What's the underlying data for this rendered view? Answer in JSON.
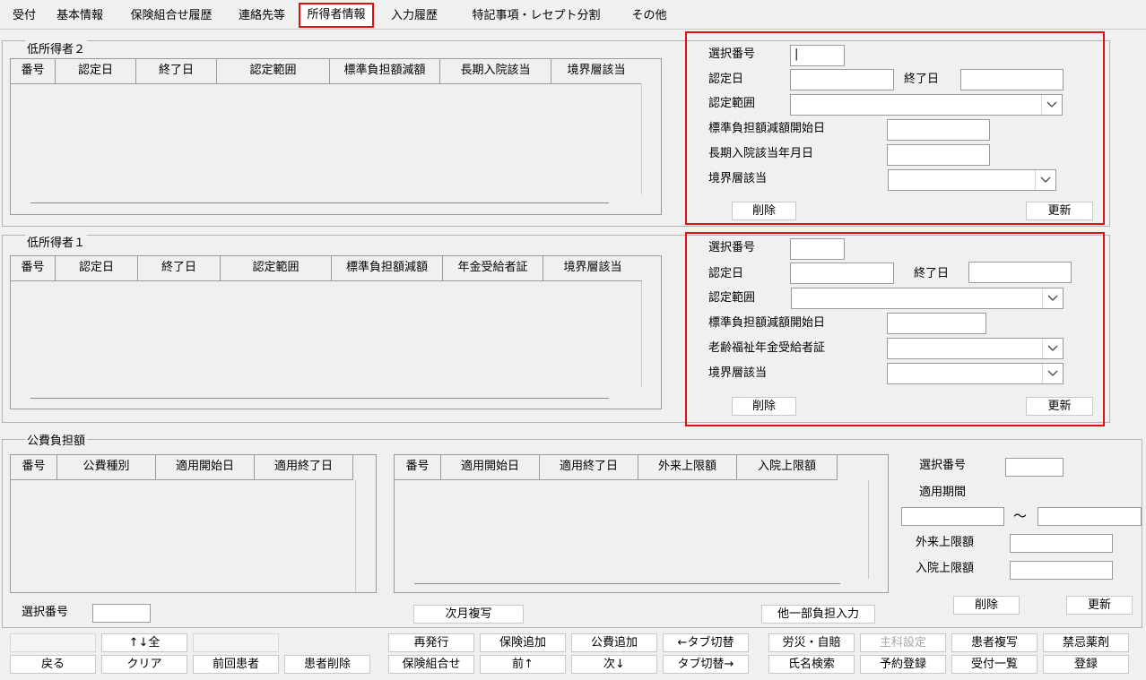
{
  "tabs": [
    {
      "label": "受付"
    },
    {
      "label": "基本情報"
    },
    {
      "label": "保険組合せ履歴"
    },
    {
      "label": "連絡先等"
    },
    {
      "label": "所得者情報"
    },
    {
      "label": "入力履歴"
    },
    {
      "label": "特記事項・レセプト分割"
    },
    {
      "label": "その他"
    }
  ],
  "low_income_2": {
    "title": "低所得者２",
    "columns": [
      "番号",
      "認定日",
      "終了日",
      "認定範囲",
      "標準負担額減額",
      "長期入院該当",
      "境界層該当"
    ],
    "form": {
      "select_number_label": "選択番号",
      "select_number_value": "|",
      "cert_date_label": "認定日",
      "end_date_label": "終了日",
      "cert_range_label": "認定範囲",
      "std_reduction_start_label": "標準負担額減額開始日",
      "long_stay_date_label": "長期入院該当年月日",
      "boundary_label": "境界層該当",
      "delete_label": "削除",
      "update_label": "更新"
    }
  },
  "low_income_1": {
    "title": "低所得者１",
    "columns": [
      "番号",
      "認定日",
      "終了日",
      "認定範囲",
      "標準負担額減額",
      "年金受給者証",
      "境界層該当"
    ],
    "form": {
      "select_number_label": "選択番号",
      "cert_date_label": "認定日",
      "end_date_label": "終了日",
      "cert_range_label": "認定範囲",
      "std_reduction_start_label": "標準負担額減額開始日",
      "pension_label": "老齢福祉年金受給者証",
      "boundary_label": "境界層該当",
      "delete_label": "削除",
      "update_label": "更新"
    }
  },
  "public_burden": {
    "title": "公費負担額",
    "left_columns": [
      "番号",
      "公費種別",
      "適用開始日",
      "適用終了日"
    ],
    "right_columns": [
      "番号",
      "適用開始日",
      "適用終了日",
      "外来上限額",
      "入院上限額"
    ],
    "select_number_label": "選択番号",
    "next_month_copy_label": "次月複写",
    "other_partial_label": "他一部負担入力",
    "form": {
      "select_number_label": "選択番号",
      "period_label": "適用期間",
      "tilde": "～",
      "outpatient_limit_label": "外来上限額",
      "inpatient_limit_label": "入院上限額",
      "delete_label": "削除",
      "update_label": "更新"
    }
  },
  "footer": {
    "up_down_all": "↑↓全",
    "back": "戻る",
    "clear": "クリア",
    "previous_patient": "前回患者",
    "delete_patient": "患者削除",
    "reissue": "再発行",
    "insurance_add": "保険追加",
    "public_add": "公費追加",
    "tab_switch_left": "←タブ切替",
    "insurance_combo": "保険組合せ",
    "prev": "前↑",
    "next": "次↓",
    "tab_switch_right": "タブ切替→",
    "rousai": "労災・自賠",
    "main_dept": "主科設定",
    "patient_copy": "患者複写",
    "contraindication": "禁忌薬剤",
    "name_search": "氏名検索",
    "reservation": "予約登録",
    "reception_list": "受付一覧",
    "register": "登録"
  }
}
